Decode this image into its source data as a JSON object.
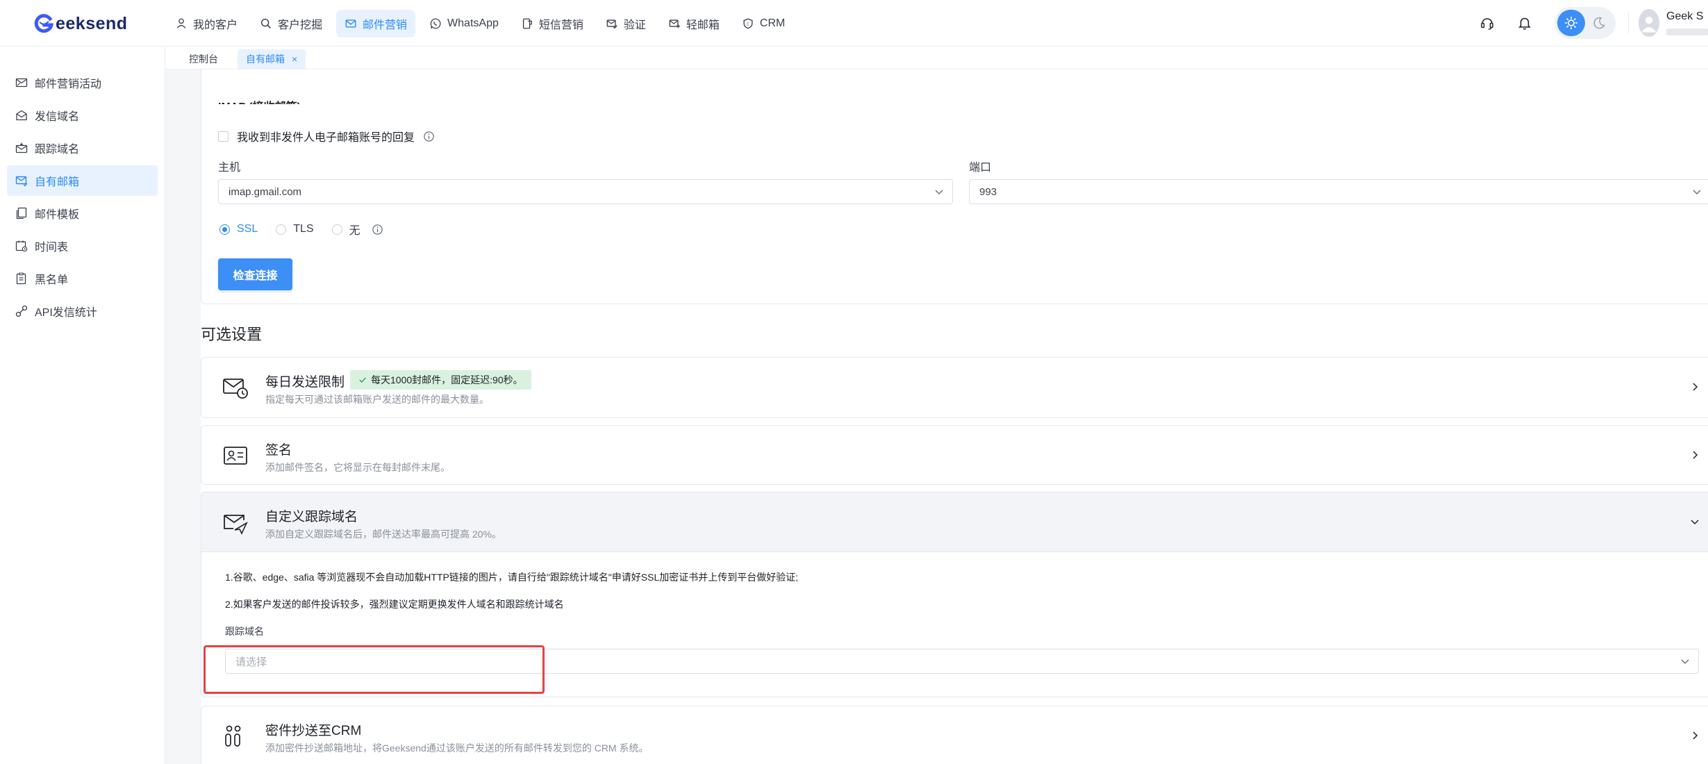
{
  "app": {
    "logo_text": "eeksend",
    "brand_color": "#3d8ef5",
    "accent_color": "#2d8cf0"
  },
  "topnav": [
    {
      "label": "我的客户",
      "icon": "user-icon",
      "active": false
    },
    {
      "label": "客户挖掘",
      "icon": "search-icon",
      "active": false
    },
    {
      "label": "邮件营销",
      "icon": "mail-icon",
      "active": true
    },
    {
      "label": "WhatsApp",
      "icon": "whatsapp-icon",
      "active": false
    },
    {
      "label": "短信营销",
      "icon": "sms-icon",
      "active": false
    },
    {
      "label": "验证",
      "icon": "verify-icon",
      "active": false
    },
    {
      "label": "轻邮箱",
      "icon": "light-mail-icon",
      "active": false
    },
    {
      "label": "CRM",
      "icon": "crm-icon",
      "active": false
    }
  ],
  "header_right": {
    "user_name": "Geek S",
    "theme": "light"
  },
  "tabs": [
    {
      "label": "控制台",
      "active": false
    },
    {
      "label": "自有邮箱",
      "active": true,
      "close": "×"
    }
  ],
  "sidebar": {
    "items": [
      {
        "label": "邮件营销活动",
        "icon": "campaign-icon",
        "active": false
      },
      {
        "label": "发信域名",
        "icon": "domain-icon",
        "active": false
      },
      {
        "label": "跟踪域名",
        "icon": "tracking-icon",
        "active": false
      },
      {
        "label": "自有邮箱",
        "icon": "mailbox-icon",
        "active": true
      },
      {
        "label": "邮件模板",
        "icon": "template-icon",
        "active": false
      },
      {
        "label": "时间表",
        "icon": "calendar-icon",
        "active": false
      },
      {
        "label": "黑名单",
        "icon": "blacklist-icon",
        "active": false
      },
      {
        "label": "API发信统计",
        "icon": "api-icon",
        "active": false
      }
    ]
  },
  "imap": {
    "title": "IMAP (接收邮箱)",
    "checkbox_label": "我收到非发件人电子邮箱账号的回复",
    "checkbox_checked": false,
    "host_label": "主机",
    "host_value": "imap.gmail.com",
    "port_label": "端口",
    "port_value": "993",
    "security_options": [
      {
        "label": "SSL",
        "selected": true
      },
      {
        "label": "TLS",
        "selected": false
      },
      {
        "label": "无",
        "selected": false
      }
    ],
    "check_button": "检查连接"
  },
  "optional": {
    "title": "可选设置",
    "daily_limit": {
      "title": "每日发送限制",
      "badge": "每天1000封邮件，固定延迟:90秒。",
      "desc": "指定每天可通过该邮箱账户发送的邮件的最大数量。"
    },
    "signature": {
      "title": "签名",
      "desc": "添加邮件签名，它将显示在每封邮件末尾。"
    },
    "tracking": {
      "title": "自定义跟踪域名",
      "desc": "添加自定义跟踪域名后，邮件送达率最高可提高 20%。",
      "note1": "1.谷歌、edge、safia 等浏览器现不会自动加载HTTP链接的图片，请自行给\"跟踪统计域名\"申请好SSL加密证书并上传到平台做好验证;",
      "note2": "2.如果客户发送的邮件投诉较多，强烈建议定期更换发件人域名和跟踪统计域名",
      "field_label": "跟踪域名",
      "placeholder": "请选择"
    },
    "crm": {
      "title": "密件抄送至CRM",
      "desc": "添加密件抄送邮箱地址，将Geeksend通过该账户发送的所有邮件转发到您的 CRM 系统。"
    }
  }
}
